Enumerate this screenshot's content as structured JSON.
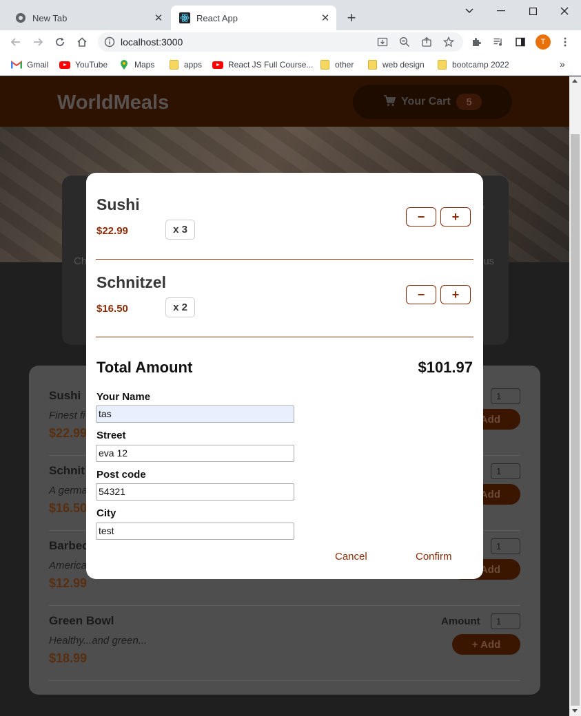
{
  "browser": {
    "tabs": [
      {
        "title": "New Tab",
        "active": false
      },
      {
        "title": "React App",
        "active": true
      }
    ],
    "address": "localhost:3000",
    "profile_initial": "T",
    "bookmarks": [
      {
        "label": "Gmail",
        "icon": "gmail-icon"
      },
      {
        "label": "YouTube",
        "icon": "youtube-icon"
      },
      {
        "label": "Maps",
        "icon": "maps-icon"
      },
      {
        "label": "apps",
        "icon": "folder-icon"
      },
      {
        "label": "React JS Full Course...",
        "icon": "youtube-icon"
      },
      {
        "label": "other",
        "icon": "folder-icon"
      },
      {
        "label": "web design",
        "icon": "folder-icon"
      },
      {
        "label": "bootcamp 2022",
        "icon": "folder-icon"
      }
    ]
  },
  "header": {
    "brand": "WorldMeals",
    "cart_label": "Your Cart",
    "cart_count": "5"
  },
  "summary_fragments": {
    "left_top": "",
    "left": "Ch",
    "right_top": "s",
    "right": "ous"
  },
  "meals": [
    {
      "name": "Sushi",
      "description": "Finest fi",
      "price": "$22.99",
      "amount": "1"
    },
    {
      "name": "Schnit",
      "description": "A germa",
      "price": "$16.50",
      "amount": "1"
    },
    {
      "name": "Barbec",
      "description": "America",
      "price": "$12.99",
      "amount": "1"
    },
    {
      "name": "Green Bowl",
      "description": "Healthy...and green...",
      "price": "$18.99",
      "amount": "1"
    }
  ],
  "meal_labels": {
    "amount": "Amount",
    "add": "+ Add",
    "add_partial": "Add"
  },
  "cart": {
    "items": [
      {
        "name": "Sushi",
        "price": "$22.99",
        "qty": "x 3"
      },
      {
        "name": "Schnitzel",
        "price": "$16.50",
        "qty": "x 2"
      }
    ],
    "minus": "−",
    "plus": "+",
    "total_label": "Total Amount",
    "total_value": "$101.97"
  },
  "checkout": {
    "name_label": "Your Name",
    "name_value": "tas",
    "street_label": "Street",
    "street_value": "eva 12",
    "postcode_label": "Post code",
    "postcode_value": "54321",
    "city_label": "City",
    "city_value": "test",
    "cancel": "Cancel",
    "confirm": "Confirm"
  },
  "colors": {
    "accent": "#8a2b06",
    "header_bg": "#2e1200",
    "overlay": "#1f1f1f"
  }
}
